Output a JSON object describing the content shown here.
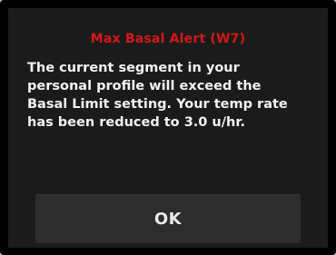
{
  "alert": {
    "title": "Max Basal Alert (W7)",
    "message_lines": [
      "The current segment in your",
      "personal profile will exceed the",
      "Basal Limit setting. Your temp rate",
      "has been reduced to 3.0 u/hr."
    ],
    "ok_label": "OK"
  },
  "colors": {
    "title": "#d41818",
    "text": "#f2f2f2",
    "screen_background": "#1b1b1b",
    "button_background": "#2d2d2d",
    "bezel": "#000000"
  }
}
